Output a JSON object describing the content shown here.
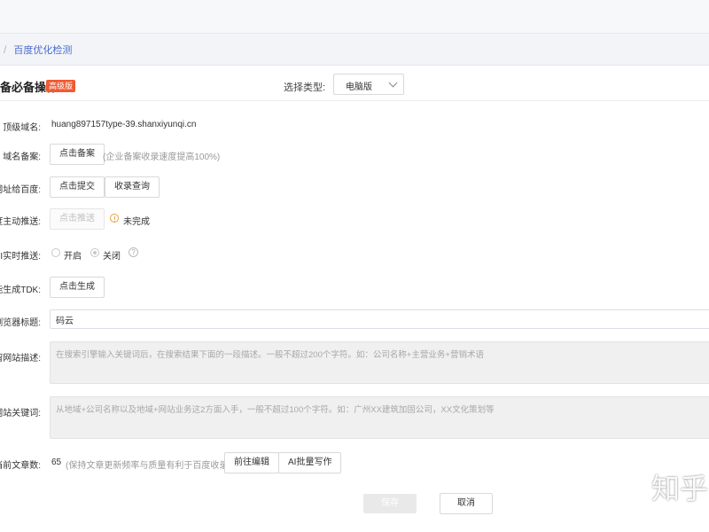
{
  "breadcrumb": {
    "separator": "/",
    "current": "百度优化检测"
  },
  "header": {
    "title": "备必备操作",
    "badge": "高级版",
    "type_label": "选择类型:",
    "type_value": "电脑版"
  },
  "form": {
    "domain": {
      "label": "顶级域名:",
      "value": "huang897157type-39.shanxiyunqi.cn"
    },
    "icp": {
      "label": "域名备案:",
      "button": "点击备案",
      "note": "(企业备案收录速度提高100%)"
    },
    "submit_baidu": {
      "label": "网址给百度:",
      "button": "点击提交",
      "button2": "收录查询"
    },
    "active_push": {
      "label": "度主动推送:",
      "button": "点击推送",
      "status": "未完成"
    },
    "api_push": {
      "label": "PI实时推送:",
      "option_on": "开启",
      "option_off": "关闭",
      "help": "?"
    },
    "tdk": {
      "label": "能生成TDK:",
      "button": "点击生成"
    },
    "browser_title": {
      "label": "浏览器标题:",
      "value": "码云"
    },
    "site_description": {
      "label": "留网站描述:",
      "placeholder": "在搜索引擎输入关键词后，在搜索结果下面的一段描述。一般不超过200个字符。如：公司名称+主营业务+营销术语"
    },
    "site_keywords": {
      "label": "网站关键词:",
      "placeholder": "从地域+公司名称以及地域+网站业务这2方面入手，一般不超过100个字符。如：广州XX建筑加固公司，XX文化策划等"
    },
    "article_count": {
      "label": "当前文章数:",
      "value": "65",
      "note": "(保持文章更新频率与质量有利于百度收录)",
      "button": "前往编辑",
      "button2": "AI批量写作"
    }
  },
  "footer": {
    "save": "保存",
    "cancel": "取消"
  },
  "watermark": "知乎"
}
